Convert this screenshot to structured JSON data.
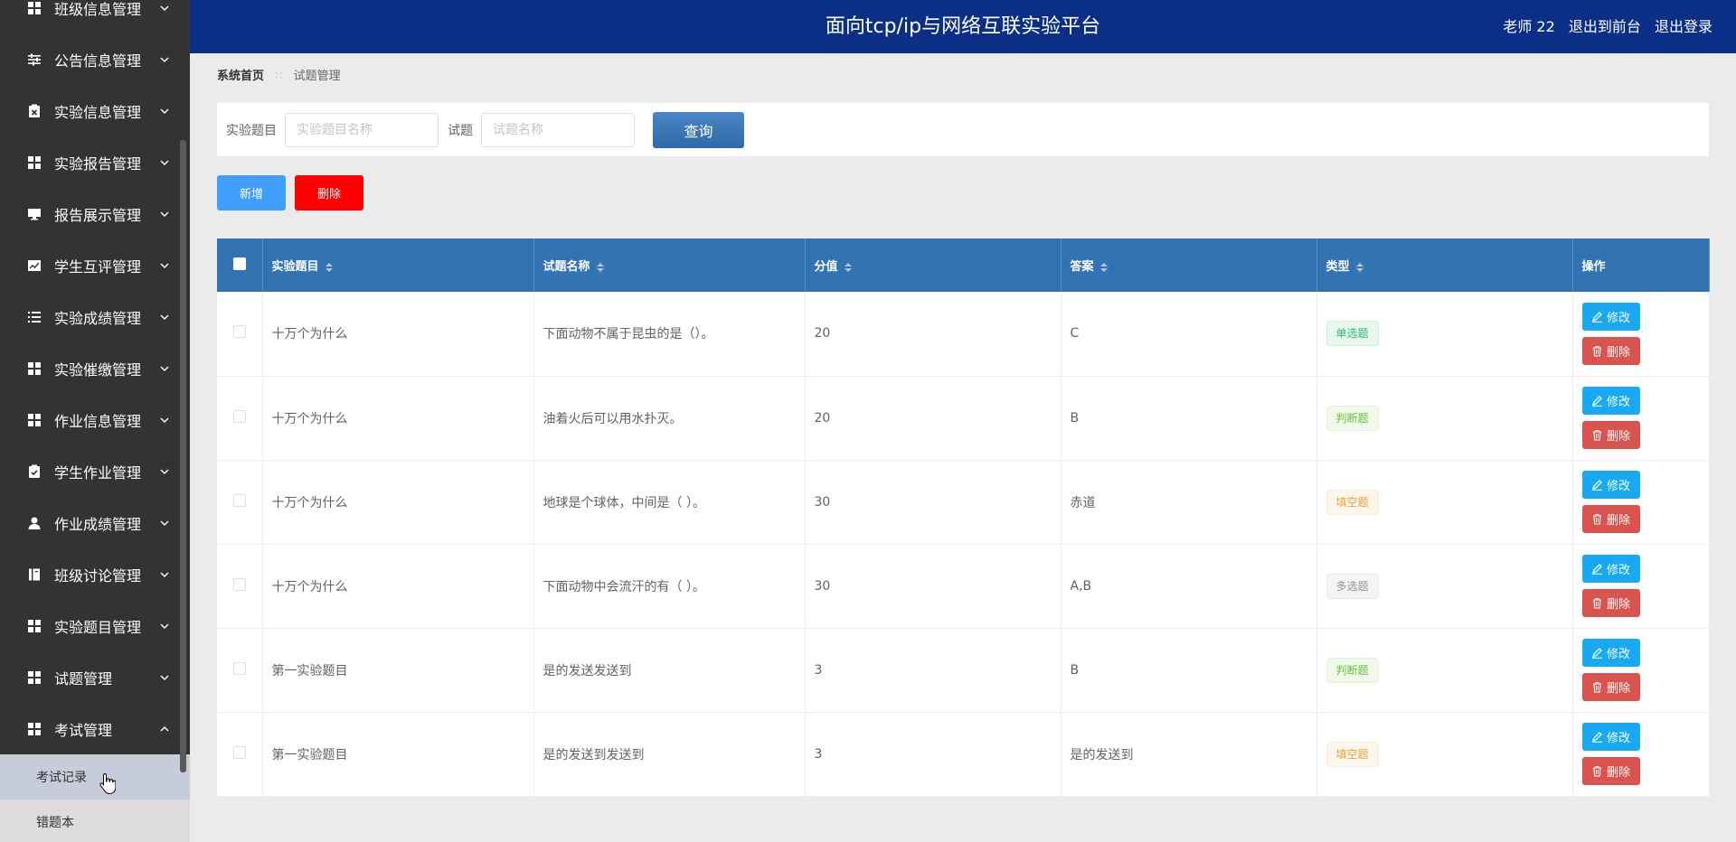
{
  "sidebar": {
    "menu_items": [
      {
        "label": "班级信息管理",
        "icon": "grid-icon"
      },
      {
        "label": "公告信息管理",
        "icon": "sliders-icon"
      },
      {
        "label": "实验信息管理",
        "icon": "clipboard-x-icon"
      },
      {
        "label": "实验报告管理",
        "icon": "grid-icon"
      },
      {
        "label": "报告展示管理",
        "icon": "monitor-icon"
      },
      {
        "label": "学生互评管理",
        "icon": "chart-icon"
      },
      {
        "label": "实验成绩管理",
        "icon": "list-icon"
      },
      {
        "label": "实验催缴管理",
        "icon": "grid-icon"
      },
      {
        "label": "作业信息管理",
        "icon": "grid-icon"
      },
      {
        "label": "学生作业管理",
        "icon": "clipboard-check-icon"
      },
      {
        "label": "作业成绩管理",
        "icon": "user-icon"
      },
      {
        "label": "班级讨论管理",
        "icon": "book-icon"
      },
      {
        "label": "实验题目管理",
        "icon": "grid-icon"
      },
      {
        "label": "试题管理",
        "icon": "grid-icon"
      },
      {
        "label": "考试管理",
        "icon": "grid-icon"
      }
    ],
    "submenu_items": [
      {
        "label": "考试记录"
      },
      {
        "label": "错题本"
      }
    ]
  },
  "header": {
    "title": "面向tcp/ip与网络互联实验平台",
    "user": "老师 22",
    "back_link": "退出到前台",
    "logout_link": "退出登录"
  },
  "breadcrumb": {
    "home": "系统首页",
    "current": "试题管理"
  },
  "search": {
    "topic_label": "实验题目",
    "topic_placeholder": "实验题目名称",
    "question_label": "试题",
    "question_placeholder": "试题名称",
    "query_button": "查询"
  },
  "actions": {
    "add_label": "新增",
    "delete_label": "删除"
  },
  "table": {
    "columns": [
      "实验题目",
      "试题名称",
      "分值",
      "答案",
      "类型",
      "操作"
    ],
    "edit_label": "修改",
    "delete_label": "删除",
    "rows": [
      {
        "topic": "十万个为什么",
        "question": "下面动物不属于昆虫的是（）。",
        "score": "20",
        "answer": "C",
        "type": "单选题",
        "type_kind": "single"
      },
      {
        "topic": "十万个为什么",
        "question": "油着火后可以用水扑灭。",
        "score": "20",
        "answer": "B",
        "type": "判断题",
        "type_kind": "judge"
      },
      {
        "topic": "十万个为什么",
        "question": "地球是个球体，中间是（ ）。",
        "score": "30",
        "answer": "赤道",
        "type": "填空题",
        "type_kind": "fill"
      },
      {
        "topic": "十万个为什么",
        "question": "下面动物中会流汗的有（ ）。",
        "score": "30",
        "answer": "A,B",
        "type": "多选题",
        "type_kind": "multi"
      },
      {
        "topic": "第一实验题目",
        "question": "是的发送发送到",
        "score": "3",
        "answer": "B",
        "type": "判断题",
        "type_kind": "judge"
      },
      {
        "topic": "第一实验题目",
        "question": "是的发送到发送到",
        "score": "3",
        "answer": "是的发送到",
        "type": "填空题",
        "type_kind": "fill"
      }
    ]
  }
}
